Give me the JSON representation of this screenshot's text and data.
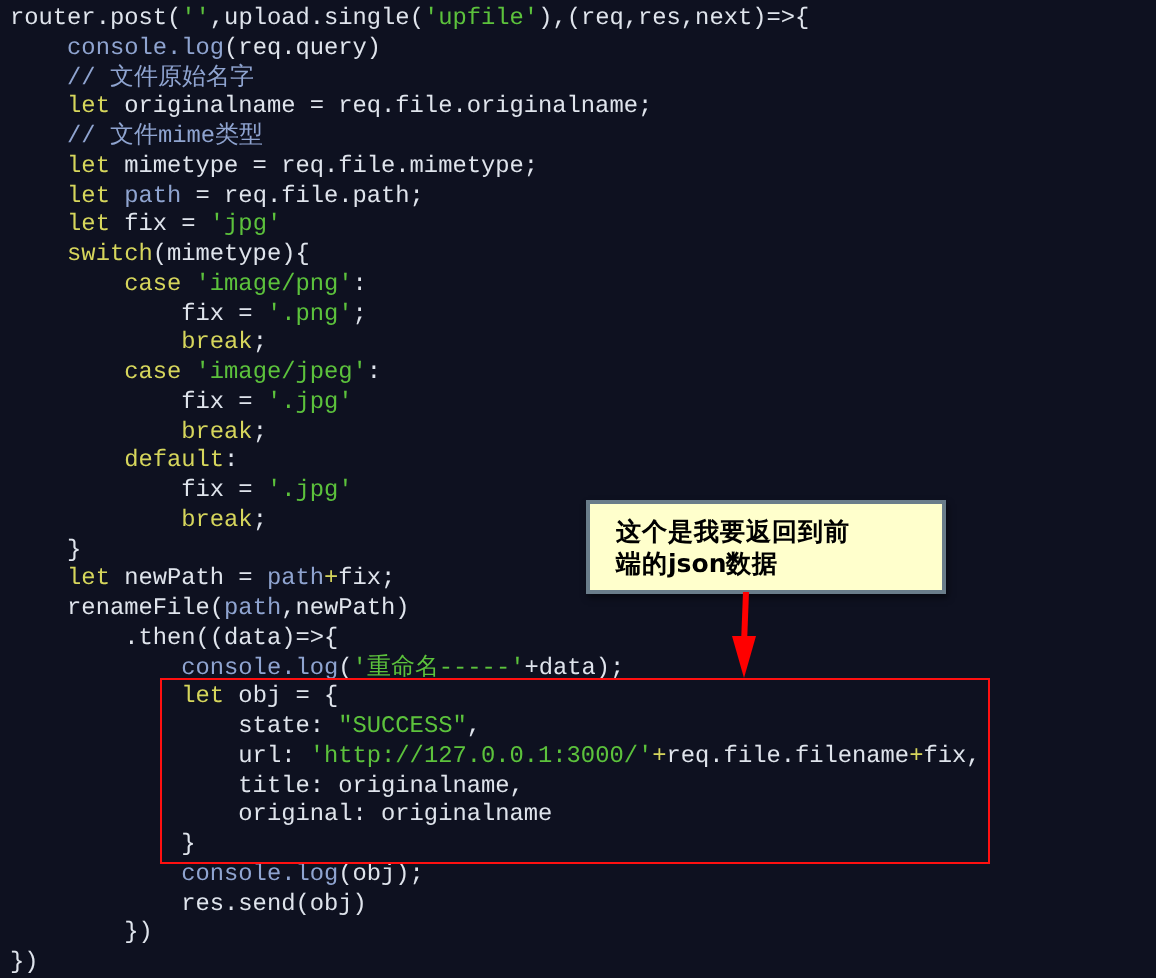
{
  "code_lines": [
    {
      "tokens": [
        {
          "kind": "plain",
          "text": "router.post("
        },
        {
          "kind": "string",
          "text": "''"
        },
        {
          "kind": "plain",
          "text": ",upload.single("
        },
        {
          "kind": "string",
          "text": "'upfile'"
        },
        {
          "kind": "plain",
          "text": "),(req,res,next)=>{"
        }
      ]
    },
    {
      "tokens": [
        {
          "kind": "muted",
          "text": "    console.log"
        },
        {
          "kind": "plain",
          "text": "(req.query)"
        }
      ]
    },
    {
      "tokens": [
        {
          "kind": "muted",
          "text": "    // 文件原始名字"
        }
      ]
    },
    {
      "tokens": [
        {
          "kind": "keyword",
          "text": "    let"
        },
        {
          "kind": "plain",
          "text": " originalname = req.file.originalname;"
        }
      ]
    },
    {
      "tokens": [
        {
          "kind": "muted",
          "text": "    // 文件mime类型"
        }
      ]
    },
    {
      "tokens": [
        {
          "kind": "keyword",
          "text": "    let"
        },
        {
          "kind": "plain",
          "text": " mimetype = req.file.mimetype;"
        }
      ]
    },
    {
      "tokens": [
        {
          "kind": "keyword",
          "text": "    let"
        },
        {
          "kind": "muted",
          "text": " path"
        },
        {
          "kind": "plain",
          "text": " = req.file.path;"
        }
      ]
    },
    {
      "tokens": [
        {
          "kind": "keyword",
          "text": "    let"
        },
        {
          "kind": "plain",
          "text": " fix = "
        },
        {
          "kind": "string",
          "text": "'jpg'"
        }
      ]
    },
    {
      "tokens": [
        {
          "kind": "keyword",
          "text": "    switch"
        },
        {
          "kind": "plain",
          "text": "(mimetype){"
        }
      ]
    },
    {
      "tokens": [
        {
          "kind": "keyword",
          "text": "        case"
        },
        {
          "kind": "string",
          "text": " 'image/png'"
        },
        {
          "kind": "plain",
          "text": ":"
        }
      ]
    },
    {
      "tokens": [
        {
          "kind": "plain",
          "text": "            fix = "
        },
        {
          "kind": "string",
          "text": "'.png'"
        },
        {
          "kind": "plain",
          "text": ";"
        }
      ]
    },
    {
      "tokens": [
        {
          "kind": "keyword",
          "text": "            break"
        },
        {
          "kind": "plain",
          "text": ";"
        }
      ]
    },
    {
      "tokens": [
        {
          "kind": "keyword",
          "text": "        case"
        },
        {
          "kind": "string",
          "text": " 'image/jpeg'"
        },
        {
          "kind": "plain",
          "text": ":"
        }
      ]
    },
    {
      "tokens": [
        {
          "kind": "plain",
          "text": "            fix = "
        },
        {
          "kind": "string",
          "text": "'.jpg'"
        }
      ]
    },
    {
      "tokens": [
        {
          "kind": "keyword",
          "text": "            break"
        },
        {
          "kind": "plain",
          "text": ";"
        }
      ]
    },
    {
      "tokens": [
        {
          "kind": "keyword",
          "text": "        default"
        },
        {
          "kind": "plain",
          "text": ":"
        }
      ]
    },
    {
      "tokens": [
        {
          "kind": "plain",
          "text": "            fix = "
        },
        {
          "kind": "string",
          "text": "'.jpg'"
        }
      ]
    },
    {
      "tokens": [
        {
          "kind": "keyword",
          "text": "            break"
        },
        {
          "kind": "plain",
          "text": ";"
        }
      ]
    },
    {
      "tokens": [
        {
          "kind": "plain",
          "text": "    }"
        }
      ]
    },
    {
      "tokens": [
        {
          "kind": "keyword",
          "text": "    let"
        },
        {
          "kind": "plain",
          "text": " newPath = "
        },
        {
          "kind": "muted",
          "text": "path"
        },
        {
          "kind": "keyword",
          "text": "+"
        },
        {
          "kind": "plain",
          "text": "fix;"
        }
      ]
    },
    {
      "tokens": [
        {
          "kind": "plain",
          "text": "    renameFile("
        },
        {
          "kind": "muted",
          "text": "path"
        },
        {
          "kind": "plain",
          "text": ",newPath)"
        }
      ]
    },
    {
      "tokens": [
        {
          "kind": "plain",
          "text": "        .then((data)=>{"
        }
      ]
    },
    {
      "tokens": [
        {
          "kind": "muted",
          "text": "            console.log"
        },
        {
          "kind": "plain",
          "text": "("
        },
        {
          "kind": "string",
          "text": "'重命名-----'"
        },
        {
          "kind": "plain",
          "text": "+data);"
        }
      ]
    },
    {
      "tokens": [
        {
          "kind": "keyword",
          "text": "            let"
        },
        {
          "kind": "plain",
          "text": " obj = {"
        }
      ]
    },
    {
      "tokens": [
        {
          "kind": "plain",
          "text": "                state: "
        },
        {
          "kind": "string",
          "text": "\"SUCCESS\""
        },
        {
          "kind": "plain",
          "text": ","
        }
      ]
    },
    {
      "tokens": [
        {
          "kind": "plain",
          "text": "                url: "
        },
        {
          "kind": "string",
          "text": "'http://127.0.0.1:3000/'"
        },
        {
          "kind": "keyword",
          "text": "+"
        },
        {
          "kind": "plain",
          "text": "req.file.filename"
        },
        {
          "kind": "keyword",
          "text": "+"
        },
        {
          "kind": "plain",
          "text": "fix,"
        }
      ]
    },
    {
      "tokens": [
        {
          "kind": "plain",
          "text": "                title: originalname,"
        }
      ]
    },
    {
      "tokens": [
        {
          "kind": "plain",
          "text": "                original: originalname"
        }
      ]
    },
    {
      "tokens": [
        {
          "kind": "plain",
          "text": "            }"
        }
      ]
    },
    {
      "tokens": [
        {
          "kind": "muted",
          "text": "            console.log"
        },
        {
          "kind": "plain",
          "text": "(obj);"
        }
      ]
    },
    {
      "tokens": [
        {
          "kind": "plain",
          "text": "            res.send(obj)"
        }
      ]
    },
    {
      "tokens": [
        {
          "kind": "plain",
          "text": "        })"
        }
      ]
    },
    {
      "tokens": [
        {
          "kind": "plain",
          "text": "})"
        }
      ]
    }
  ],
  "callout": {
    "text": "这个是我要返回到前端的json数据"
  }
}
